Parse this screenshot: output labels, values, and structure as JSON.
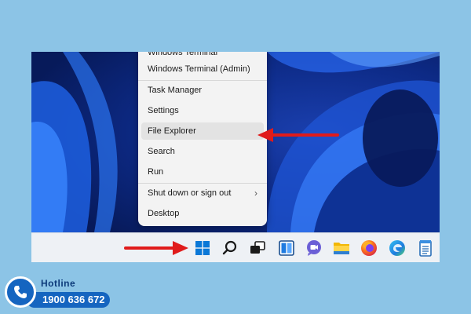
{
  "context_menu": {
    "items": [
      {
        "label": "Windows Terminal"
      },
      {
        "label": "Windows Terminal (Admin)"
      },
      {
        "label": "Task Manager"
      },
      {
        "label": "Settings"
      },
      {
        "label": "File Explorer",
        "highlighted": true
      },
      {
        "label": "Search"
      },
      {
        "label": "Run"
      },
      {
        "label": "Shut down or sign out",
        "submenu": true
      },
      {
        "label": "Desktop"
      }
    ]
  },
  "taskbar": {
    "icons": [
      "windows-start-icon",
      "search-icon",
      "task-view-icon",
      "widgets-icon",
      "teams-chat-icon",
      "file-explorer-icon",
      "firefox-icon",
      "edge-icon",
      "notepad-icon"
    ]
  },
  "annotations": {
    "arrow_color": "#e01b1b",
    "targets": [
      "File Explorer",
      "windows-start-icon"
    ]
  },
  "hotline": {
    "label": "Hotline",
    "number": "1900 636 672"
  },
  "colors": {
    "page_background": "#8cc4e6",
    "accent": "#1565c0",
    "start_button": "#0a78d7"
  }
}
